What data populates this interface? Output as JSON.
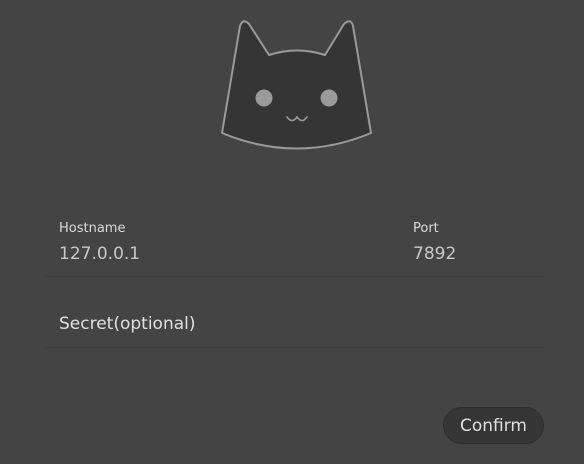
{
  "logo": {
    "icon": "cat-face-icon",
    "stroke_color": "#9a9a9a",
    "fill_color": "#353535"
  },
  "form": {
    "hostname": {
      "label": "Hostname",
      "value": "127.0.0.1"
    },
    "port": {
      "label": "Port",
      "value": "7892"
    },
    "secret": {
      "placeholder": "Secret(optional)",
      "value": ""
    }
  },
  "actions": {
    "confirm_label": "Confirm"
  }
}
